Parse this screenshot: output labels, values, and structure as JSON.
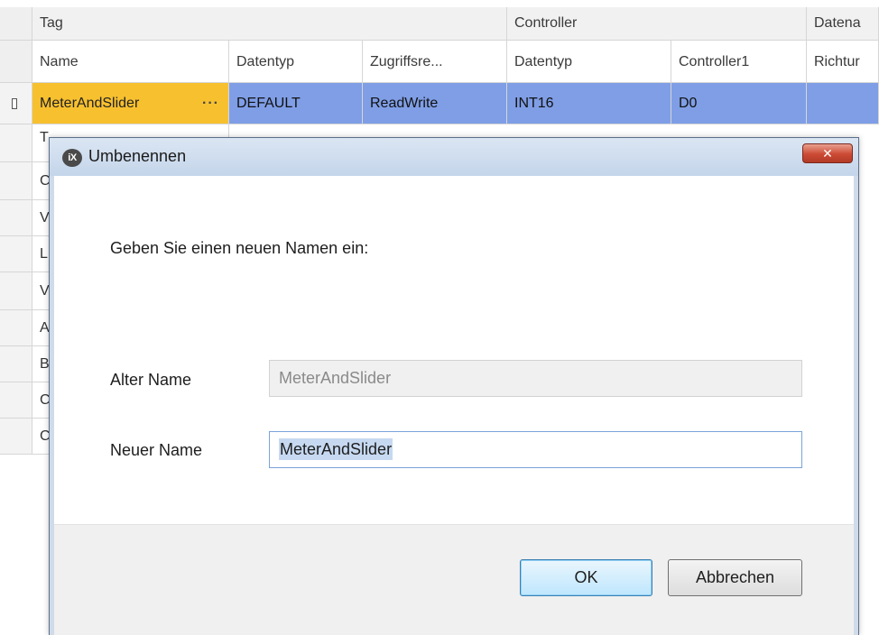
{
  "grid": {
    "group_headers": [
      "Tag",
      "Controller",
      "Datena"
    ],
    "column_headers": [
      "Name",
      "Datentyp",
      "Zugriffsre...",
      "Datentyp",
      "Controller1",
      "Richtur"
    ],
    "selected_row": {
      "name": "MeterAndSlider",
      "ellipsis": "···",
      "datatype": "DEFAULT",
      "access": "ReadWrite",
      "controller_datatype": "INT16",
      "controller1": "D0",
      "direction": ""
    },
    "partial_rows": [
      "T",
      "C",
      "V",
      "L",
      "V",
      "A",
      "B",
      "C",
      "C"
    ]
  },
  "dialog": {
    "app_icon": "iX",
    "title": "Umbenennen",
    "close_symbol": "✕",
    "prompt": "Geben Sie einen neuen Namen ein:",
    "old_name_label": "Alter Name",
    "old_name_value": "MeterAndSlider",
    "new_name_label": "Neuer Name",
    "new_name_value": "MeterAndSlider",
    "ok_label": "OK",
    "cancel_label": "Abbrechen"
  },
  "colors": {
    "selected_row": "#7f9ee6",
    "selected_name_cell": "#f7c02f",
    "close_button": "#cc4a34",
    "titlebar": "#c4d5ea"
  }
}
